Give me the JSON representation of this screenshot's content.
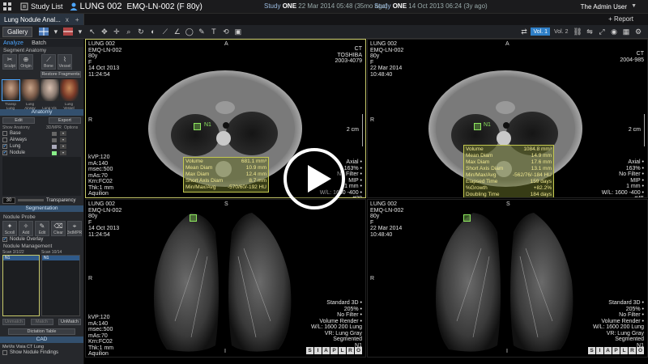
{
  "topbar": {
    "study_list": "Study List",
    "patient_name": "LUNG 002",
    "patient_id": "EMQ-LN-002 (F 80y)",
    "study1_label": "Study",
    "study1_name": "ONE",
    "study1_date": "22 Mar 2014 05:48",
    "study1_ago": "(35mo ago)",
    "study2_label": "Study",
    "study2_name": "ONE",
    "study2_date": "14 Oct 2013 06:24",
    "study2_ago": "(3y ago)",
    "user": "The Admin User"
  },
  "tabbar": {
    "tab_label": "Lung Nodule Anal...",
    "close": "x",
    "add": "+",
    "report": "+ Report"
  },
  "toolbar": {
    "gallery": "Gallery",
    "vol1": "Vol. 1",
    "vol2": "Vol. 2"
  },
  "left": {
    "tab_analyze": "Analyze",
    "tab_batch": "Batch",
    "seg_anatomy": "Segment Anatomy",
    "btn_sculpt": "Sculpt",
    "btn_origin": "Origin",
    "btn_bone": "Bone",
    "btn_vessel": "Vessel",
    "restore": "Restore Fragments",
    "thumbs": [
      "Transp Lung",
      "Lung Airway",
      "Lung Vis",
      "Lung Vessel"
    ],
    "anatomy_head": "Anatomy",
    "edit": "Edit",
    "export": "Export",
    "col_show": "Show",
    "col_anatomy": "Anatomy",
    "col_mpr": "3D/MPR",
    "col_options": "Options",
    "anatomy_rows": [
      "Base",
      "Airways",
      "Lung",
      "Nodule"
    ],
    "transparency_value": "30",
    "transparency": "Transparency",
    "segmentation_head": "Segmentation",
    "nodule_probe": "Nodule Probe",
    "seg_btns": [
      "Scroll",
      "Add",
      "Edit",
      "Clear",
      "3rdMPR"
    ],
    "nodule_overlay": "Nodule Overlay",
    "nodule_mgmt": "Nodule Management",
    "scan1": "Scan 3/1/22",
    "scan2": "Scan 10/14",
    "n1_a": "N1",
    "n1_b": "N1",
    "btn_unmatch": "Unmatch",
    "btn_match": "Match",
    "btn_unmatch2": "UnMatch",
    "dictation": "Dictation Table",
    "cad_head": "CAD",
    "cad_label": "MeVis Visia CT Lung",
    "show_findings": "Show Nodule Findings"
  },
  "viewports": {
    "tl": {
      "info_left": "LUNG 002\nEMQ-LN-002\n80y\nF\n14 Oct 2013\n11:24:54",
      "info_right": "CT\nTOSHIBA\n2003-4079",
      "orient_top": "A",
      "orient_left": "R",
      "scale": "2 cm",
      "bottom_left": "kVP:120\nmA:140\nmsec:500\nmAs:70\nKrn:FC02\nThk:1 mm\nAquilion",
      "bottom_right": "Axial •\n163% •\nNo Filter •\nMIP •\n1 mm •\nW/L: 1600 -400 •\n#38",
      "n1": "N1",
      "meas": [
        [
          "Volume",
          "681.1 mm³"
        ],
        [
          "Mean Diam",
          "10.9 mm"
        ],
        [
          "Max Diam",
          "12.4 mm"
        ],
        [
          "Short Axis Diam",
          "8.7 mm"
        ],
        [
          "Min/Max/Avg",
          "-570/60/-192 HU"
        ]
      ]
    },
    "tr": {
      "info_left": "LUNG 002\nEMQ-LN-002\n80y\nF\n22 Mar 2014\n10:48:40",
      "info_right": "CT\n2004-985",
      "orient_top": "A",
      "orient_left": "R",
      "scale": "2 cm",
      "bottom_right": "Axial •\n163% •\nNo Filter •\nMIP •\n1 mm •\nW/L: 1600 -400 •\n#45",
      "n1": "N1",
      "meas": [
        [
          "Volume",
          "1084.8 mm³"
        ],
        [
          "Mean Diam",
          "14.9 mm"
        ],
        [
          "Max Diam",
          "17.6 mm"
        ],
        [
          "Short Axis Diam",
          "13.1 mm"
        ],
        [
          "Min/Max/Avg",
          "-562/76/-184 HU"
        ],
        [
          "Elapsed Time",
          "159 days"
        ],
        [
          "%Growth",
          "+82.2%"
        ],
        [
          "Doubling Time",
          "184 days"
        ]
      ]
    },
    "bl": {
      "info_left": "LUNG 002\nEMQ-LN-002\n80y\nF\n14 Oct 2013\n11:24:54",
      "orient_top": "S",
      "orient_left": "R",
      "orient_bottom": "I",
      "bottom_left": "kVP:120\nmA:140\nmsec:500\nmAs:70\nKrn:FC02\nThk:1 mm\nAquilion",
      "bottom_right": "Standard 3D •\n205% •\nNo Filter •\nVolume Render •\nW/L: 1600 200 Lung\nVR: Lung Gray\nSegmented\nN1"
    },
    "br": {
      "info_left": "LUNG 002\nEMQ-LN-002\n80y\nF\n22 Mar 2014\n10:48:40",
      "orient_top": "S",
      "orient_left": "R",
      "orient_bottom": "I",
      "bottom_right": "Standard 3D •\n205% •\nNo Filter •\nVolume Render •\nW/L: 1600 200 Lung\nVR: Lung Gray\nSegmented\nN1"
    },
    "orient_letters": [
      "S",
      "I",
      "A",
      "P",
      "L",
      "R",
      "O"
    ]
  },
  "colors": {
    "accent": "#2f7fc7",
    "measure": "#c4c850",
    "nodule": "#8ee85f"
  }
}
